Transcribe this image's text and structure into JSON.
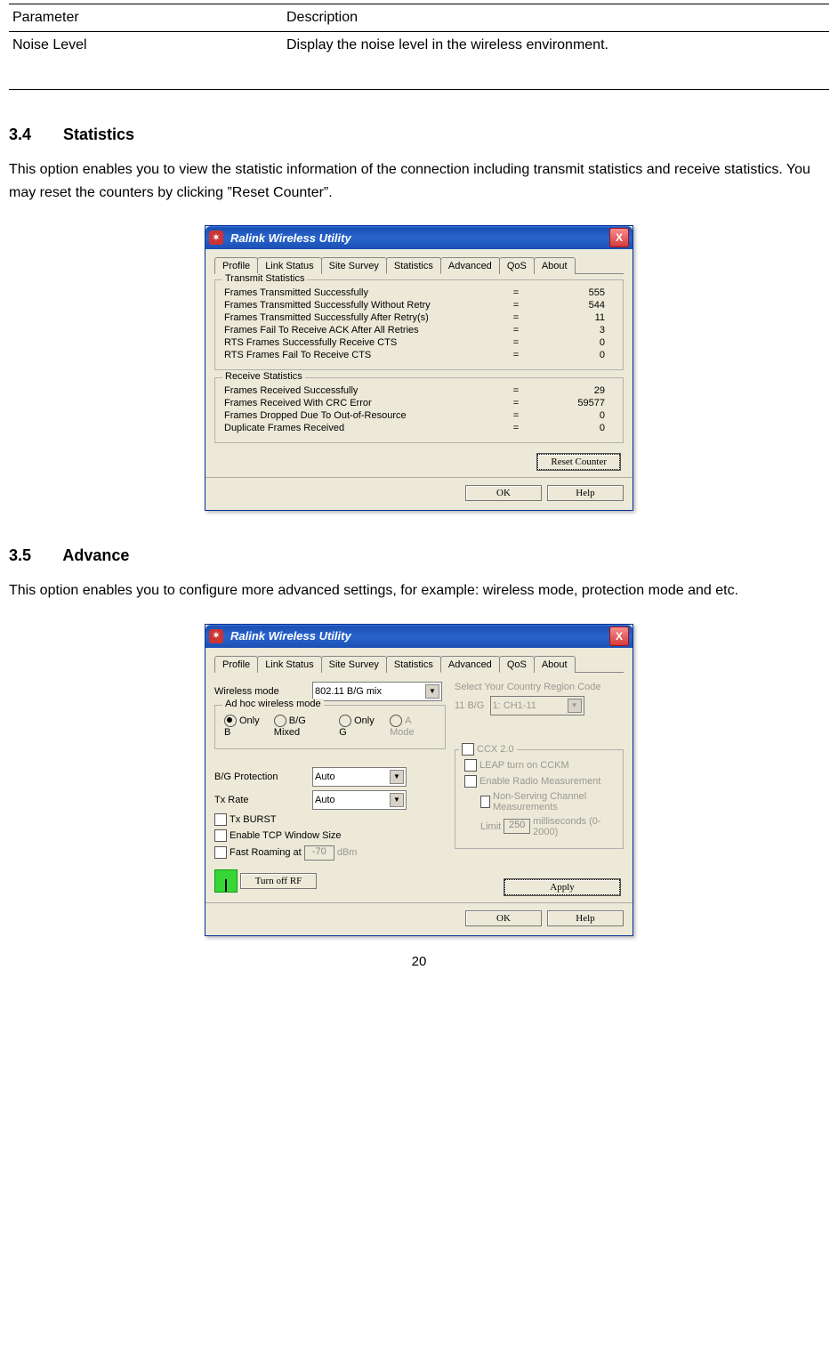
{
  "param_table": {
    "headers": [
      "Parameter",
      "Description"
    ],
    "rows": [
      {
        "param": "Noise Level",
        "desc": "Display the noise level in the wireless environment."
      }
    ]
  },
  "section34": {
    "num": "3.4",
    "title": "Statistics",
    "body": "This option enables you to view the statistic information of the connection including transmit statistics and receive statistics. You may reset the counters by clicking ”Reset Counter”."
  },
  "section35": {
    "num": "3.5",
    "title": "Advance",
    "body": "This option enables you to configure more advanced settings, for example: wireless mode, protection mode and etc."
  },
  "page_number": "20",
  "dialog_common": {
    "title": "Ralink Wireless Utility",
    "tabs": [
      "Profile",
      "Link Status",
      "Site Survey",
      "Statistics",
      "Advanced",
      "QoS",
      "About"
    ],
    "ok": "OK",
    "help": "Help"
  },
  "dlg_stats": {
    "active_tab": "Statistics",
    "tx_group": "Transmit Statistics",
    "rx_group": "Receive Statistics",
    "tx_rows": [
      {
        "label": "Frames Transmitted Successfully",
        "value": "555"
      },
      {
        "label": "Frames Transmitted Successfully  Without Retry",
        "value": "544"
      },
      {
        "label": "Frames Transmitted Successfully After Retry(s)",
        "value": "11"
      },
      {
        "label": "Frames Fail To Receive ACK After All Retries",
        "value": "3"
      },
      {
        "label": "RTS Frames Successfully Receive CTS",
        "value": "0"
      },
      {
        "label": "RTS Frames Fail To Receive CTS",
        "value": "0"
      }
    ],
    "rx_rows": [
      {
        "label": "Frames Received Successfully",
        "value": "29"
      },
      {
        "label": "Frames Received With CRC Error",
        "value": "59577"
      },
      {
        "label": "Frames Dropped Due To Out-of-Resource",
        "value": "0"
      },
      {
        "label": "Duplicate Frames Received",
        "value": "0"
      }
    ],
    "reset_label": "Reset Counter"
  },
  "dlg_adv": {
    "active_tab": "Advanced",
    "wireless_mode_lbl": "Wireless mode",
    "wireless_mode_val": "802.11 B/G mix",
    "adhoc_group": "Ad hoc wireless mode",
    "adhoc_options": [
      "Only B",
      "B/G Mixed",
      "Only G",
      "A Mode"
    ],
    "adhoc_selected": 0,
    "bg_prot_lbl": "B/G Protection",
    "bg_prot_val": "Auto",
    "tx_rate_lbl": "Tx Rate",
    "tx_rate_val": "Auto",
    "tx_burst": "Tx BURST",
    "tcp_win": "Enable TCP Window Size",
    "fast_roam": "Fast Roaming at",
    "fast_roam_val": "-70",
    "fast_roam_unit": "dBm",
    "turn_off_rf": "Turn off RF",
    "country_lbl": "Select Your Country Region Code",
    "band_lbl": "11 B/G",
    "country_val": "1: CH1-11",
    "ccx_group": "CCX 2.0",
    "leap": "LEAP turn on CCKM",
    "radio_meas": "Enable Radio Measurement",
    "non_serving": "Non-Serving Channel Measurements",
    "limit_lbl": "Limit",
    "limit_val": "250",
    "limit_unit": "milliseconds (0-2000)",
    "apply": "Apply"
  }
}
